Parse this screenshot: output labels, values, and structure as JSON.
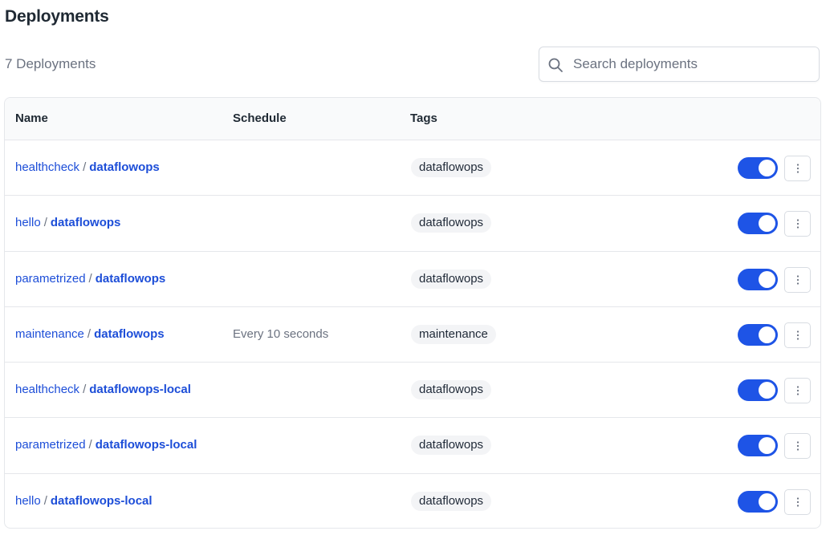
{
  "page": {
    "title": "Deployments",
    "count_label": "7 Deployments"
  },
  "search": {
    "placeholder": "Search deployments",
    "value": "",
    "icon": "search-icon"
  },
  "table": {
    "columns": {
      "name": "Name",
      "schedule": "Schedule",
      "tags": "Tags",
      "actions": ""
    },
    "rows": [
      {
        "flow": "healthcheck",
        "separator": "/",
        "deployment": "dataflowops",
        "schedule": "",
        "tag": "dataflowops",
        "active": true
      },
      {
        "flow": "hello",
        "separator": "/",
        "deployment": "dataflowops",
        "schedule": "",
        "tag": "dataflowops",
        "active": true
      },
      {
        "flow": "parametrized",
        "separator": "/",
        "deployment": "dataflowops",
        "schedule": "",
        "tag": "dataflowops",
        "active": true
      },
      {
        "flow": "maintenance",
        "separator": "/",
        "deployment": "dataflowops",
        "schedule": "Every 10 seconds",
        "tag": "maintenance",
        "active": true
      },
      {
        "flow": "healthcheck",
        "separator": "/",
        "deployment": "dataflowops-local",
        "schedule": "",
        "tag": "dataflowops",
        "active": true
      },
      {
        "flow": "parametrized",
        "separator": "/",
        "deployment": "dataflowops-local",
        "schedule": "",
        "tag": "dataflowops",
        "active": true
      },
      {
        "flow": "hello",
        "separator": "/",
        "deployment": "dataflowops-local",
        "schedule": "",
        "tag": "dataflowops",
        "active": true
      }
    ]
  },
  "colors": {
    "accent": "#1e54e6",
    "link": "#1d4ed8"
  }
}
